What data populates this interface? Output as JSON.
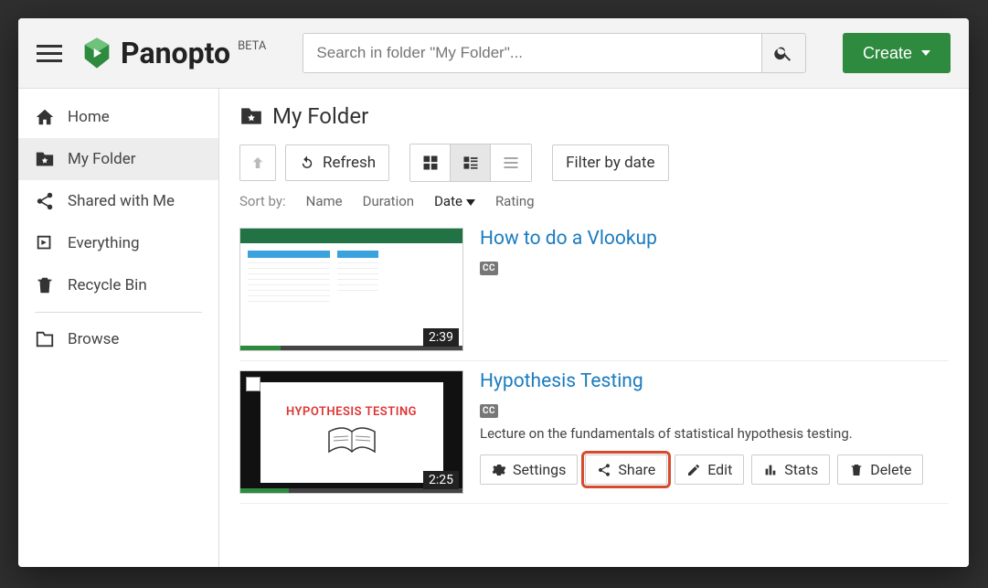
{
  "brand": {
    "name": "Panopto",
    "badge": "BETA"
  },
  "search": {
    "placeholder": "Search in folder \"My Folder\"..."
  },
  "create_label": "Create",
  "sidebar": {
    "items": [
      {
        "id": "home",
        "label": "Home"
      },
      {
        "id": "my-folder",
        "label": "My Folder",
        "active": true
      },
      {
        "id": "shared",
        "label": "Shared with Me"
      },
      {
        "id": "everything",
        "label": "Everything"
      },
      {
        "id": "recycle",
        "label": "Recycle Bin"
      }
    ],
    "browse_label": "Browse"
  },
  "folder_title": "My Folder",
  "toolbar": {
    "refresh": "Refresh",
    "filter": "Filter by date"
  },
  "sort": {
    "label": "Sort by:",
    "options": [
      "Name",
      "Duration",
      "Date",
      "Rating"
    ],
    "active": "Date",
    "direction": "desc"
  },
  "videos": [
    {
      "title": "How to do a Vlookup",
      "duration": "2:39",
      "cc": true,
      "cc_label": "CC",
      "description": "",
      "progress_pct": 18
    },
    {
      "title": "Hypothesis Testing",
      "duration": "2:25",
      "cc": true,
      "cc_label": "CC",
      "slide_text": "HYPOTHESIS TESTING",
      "description": "Lecture on the fundamentals of statistical hypothesis testing.",
      "progress_pct": 22,
      "actions": {
        "settings": "Settings",
        "share": "Share",
        "edit": "Edit",
        "stats": "Stats",
        "delete": "Delete"
      }
    }
  ]
}
